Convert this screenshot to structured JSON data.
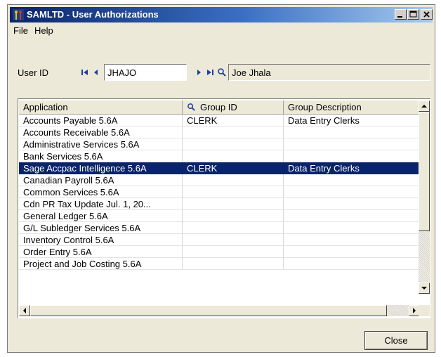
{
  "window": {
    "title": "SAMLTD - User Authorizations",
    "icon": "sage-accpac-icon"
  },
  "menu": [
    {
      "label": "File"
    },
    {
      "label": "Help"
    }
  ],
  "user": {
    "label": "User ID",
    "id_value": "JHAJO",
    "name_value": "Joe Jhala"
  },
  "grid": {
    "columns": [
      {
        "label": "Application"
      },
      {
        "label": "Group ID",
        "icon": "search-icon"
      },
      {
        "label": "Group Description"
      }
    ],
    "rows": [
      {
        "application": "Accounts Payable 5.6A",
        "group_id": "CLERK",
        "group_description": "Data Entry Clerks"
      },
      {
        "application": "Accounts Receivable 5.6A",
        "group_id": "",
        "group_description": ""
      },
      {
        "application": "Administrative Services 5.6A",
        "group_id": "",
        "group_description": ""
      },
      {
        "application": "Bank Services 5.6A",
        "group_id": "",
        "group_description": ""
      },
      {
        "application": "Sage Accpac Intelligence 5.6A",
        "group_id": "CLERK",
        "group_description": "Data Entry Clerks",
        "selected": true
      },
      {
        "application": "Canadian Payroll 5.6A",
        "group_id": "",
        "group_description": ""
      },
      {
        "application": "Common Services 5.6A",
        "group_id": "",
        "group_description": ""
      },
      {
        "application": "Cdn PR Tax Update Jul. 1, 20...",
        "group_id": "",
        "group_description": ""
      },
      {
        "application": "General Ledger 5.6A",
        "group_id": "",
        "group_description": ""
      },
      {
        "application": "G/L Subledger Services 5.6A",
        "group_id": "",
        "group_description": ""
      },
      {
        "application": "Inventory Control 5.6A",
        "group_id": "",
        "group_description": ""
      },
      {
        "application": "Order Entry 5.6A",
        "group_id": "",
        "group_description": ""
      },
      {
        "application": "Project and Job Costing 5.6A",
        "group_id": "",
        "group_description": ""
      }
    ]
  },
  "buttons": {
    "close": "Close"
  },
  "colors": {
    "selection": "#0a246a",
    "title_gradient_start": "#0a246a",
    "title_gradient_end": "#a6caf0",
    "dialog_face": "#ece9d8"
  }
}
